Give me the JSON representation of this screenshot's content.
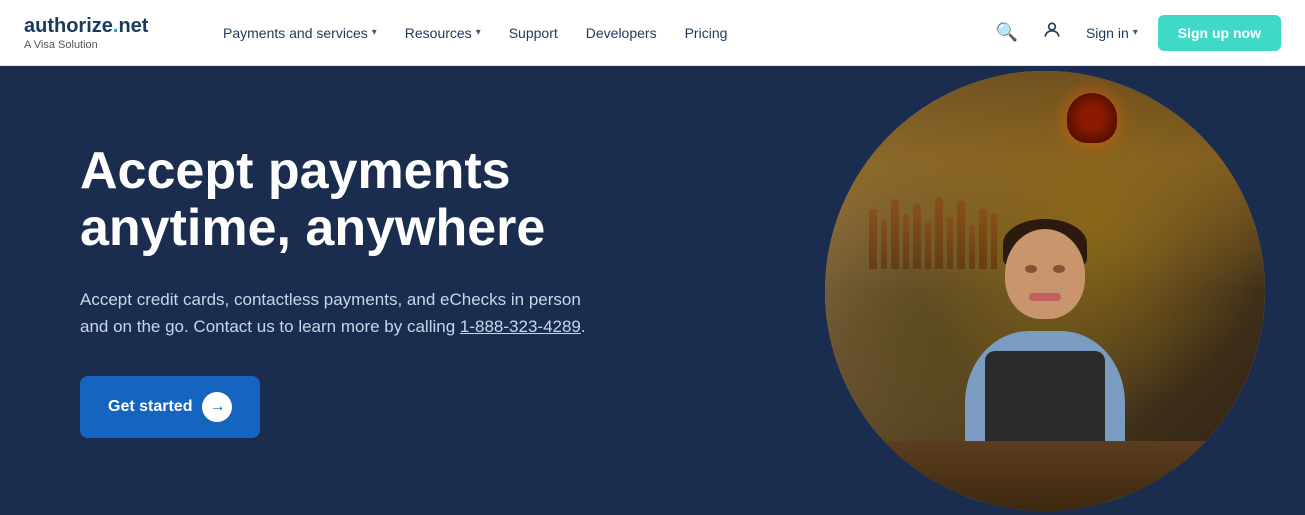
{
  "logo": {
    "brand": "authorize",
    "dot": ".",
    "ext": "net",
    "subtitle": "A Visa Solution"
  },
  "nav": {
    "payments_label": "Payments and services",
    "resources_label": "Resources",
    "support_label": "Support",
    "developers_label": "Developers",
    "pricing_label": "Pricing",
    "signin_label": "Sign in",
    "signup_label": "Sign up now"
  },
  "hero": {
    "title": "Accept payments anytime, anywhere",
    "description_part1": "Accept credit cards, contactless payments, and eChecks in person and on the go. Contact us to learn more by calling ",
    "phone": "1-888-323-4289",
    "description_part2": ".",
    "cta_label": "Get started"
  },
  "icons": {
    "search": "🔍",
    "account": "👤",
    "chevron_down": "▾",
    "arrow_right": "→"
  },
  "colors": {
    "nav_bg": "#ffffff",
    "hero_bg": "#1b2d4e",
    "signup_bg": "#40d9c8",
    "cta_bg": "#1565c0",
    "logo_color": "#1a3a5c",
    "accent": "#00adef"
  }
}
